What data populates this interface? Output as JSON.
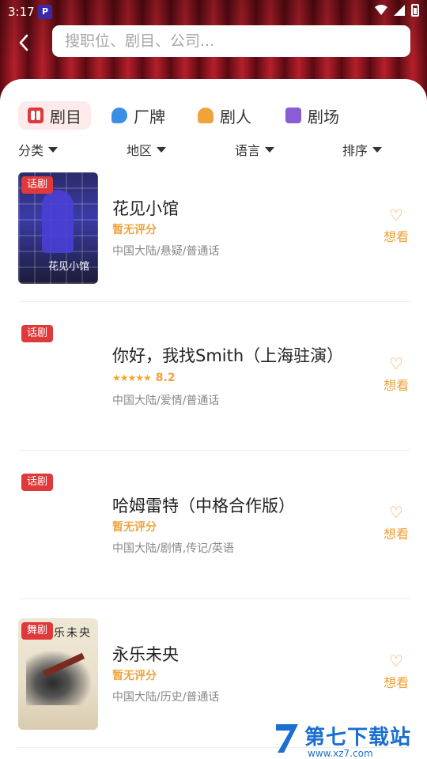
{
  "statusbar": {
    "time": "3:17",
    "app_icon": "P"
  },
  "search": {
    "placeholder": "搜职位、剧目、公司..."
  },
  "category_tabs": [
    {
      "label": "剧目",
      "icon": "theater-masks-icon",
      "active": true,
      "color": "#e0393b"
    },
    {
      "label": "厂牌",
      "icon": "tag-icon",
      "active": false,
      "color": "#3a8ee6"
    },
    {
      "label": "剧人",
      "icon": "person-icon",
      "active": false,
      "color": "#f0a23b"
    },
    {
      "label": "剧场",
      "icon": "theater-icon",
      "active": false,
      "color": "#8a5cd6"
    }
  ],
  "filters": [
    {
      "label": "分类"
    },
    {
      "label": "地区"
    },
    {
      "label": "语言"
    },
    {
      "label": "排序"
    }
  ],
  "items": [
    {
      "badge": "话剧",
      "title": "花见小馆",
      "rating_text": "暂无评分",
      "meta": "中国大陆/悬疑/普通话",
      "want": "想看",
      "poster_text": "花见小馆"
    },
    {
      "badge": "话剧",
      "title": "你好，我找Smith（上海驻演）",
      "rating_score": "8.2",
      "stars": "★★★★★",
      "meta": "中国大陆/爱情/普通话",
      "want": "想看"
    },
    {
      "badge": "话剧",
      "title": "哈姆雷特（中格合作版）",
      "rating_text": "暂无评分",
      "meta": "中国大陆/剧情,传记/英语",
      "want": "想看"
    },
    {
      "badge": "舞剧",
      "title": "永乐未央",
      "rating_text": "暂无评分",
      "meta": "中国大陆/历史/普通话",
      "want": "想看",
      "poster_text": "永乐未央"
    }
  ],
  "watermark": {
    "text": "第七下载站",
    "sub": "www.xz7.com"
  }
}
